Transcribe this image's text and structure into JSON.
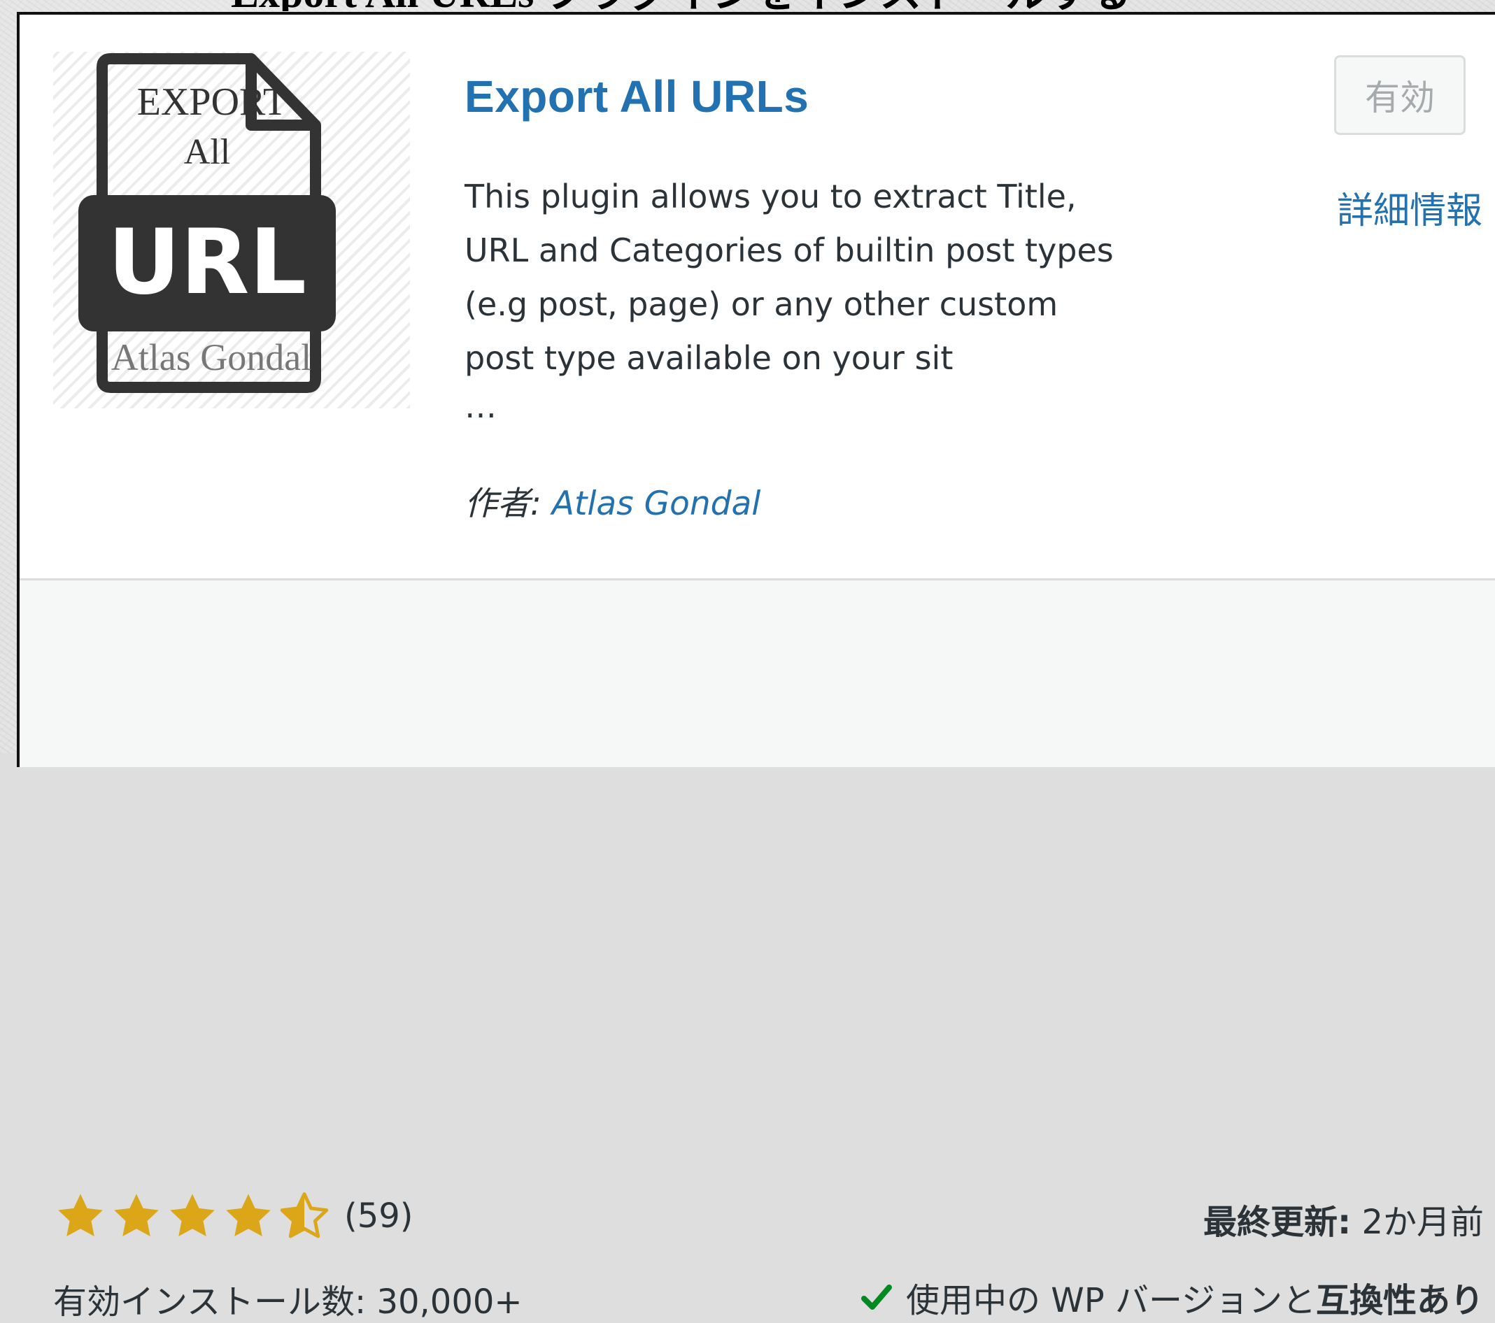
{
  "page": {
    "top_heading_fragment": "Export All URLs プラグインをインストールする"
  },
  "plugin": {
    "icon": {
      "top_text": "EXPORT",
      "middle_text": "All",
      "badge_text": "URL",
      "bottom_text": "Atlas Gondal",
      "name": "export-all-url-file-icon"
    },
    "title": "Export All URLs",
    "description": "This plugin allows you to extract Title, URL and Categories of builtin post types (e.g post, page) or any other custom post type available on your sit",
    "description_ellipsis": "…",
    "author_label": "作者:",
    "author_name": "Atlas Gondal",
    "install_button_label": "有効",
    "more_details_label": "詳細情報"
  },
  "footer": {
    "rating": {
      "value": 4.5,
      "max": 5,
      "count_text": "(59)",
      "star_color": "#dba617"
    },
    "installs_text": "有効インストール数: 30,000+",
    "last_updated_label": "最終更新:",
    "last_updated_value": "2か月前",
    "compat_prefix": "使用中の WP バージョンと",
    "compat_status": "互換性あり",
    "compat_icon": "check-icon",
    "compat_color": "#008a20"
  },
  "colors": {
    "link": "#2271b1",
    "text": "#2c3338",
    "disabled_button_text": "#a7aaad"
  }
}
